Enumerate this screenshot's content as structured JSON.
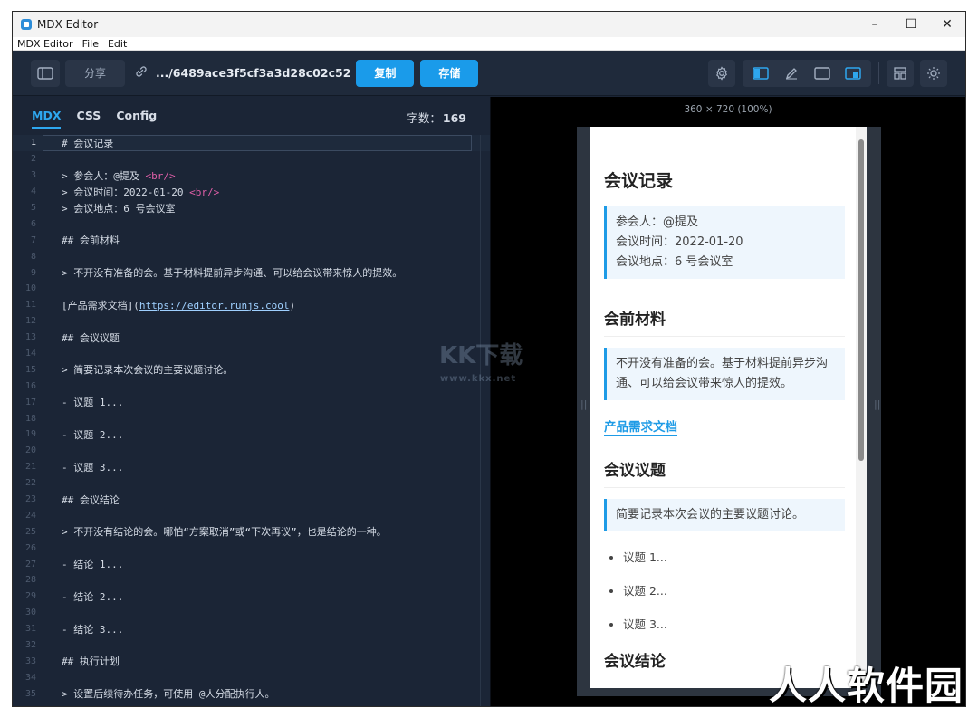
{
  "window": {
    "title": "MDX Editor",
    "controls": [
      "–",
      "☐",
      "✕"
    ]
  },
  "menu": [
    "MDX Editor",
    "File",
    "Edit"
  ],
  "toolbar": {
    "share_label": "分享",
    "path": ".../6489ace3f5cf3a3d28c02c52",
    "copy_label": "复制",
    "save_label": "存储",
    "icons": [
      "sidebar-icon",
      "link-icon",
      "gear-icon",
      "split-view-icon",
      "edit-icon",
      "preview-icon",
      "mobile-preview-icon",
      "layout-icon",
      "theme-icon"
    ]
  },
  "editor": {
    "tabs": [
      "MDX",
      "CSS",
      "Config"
    ],
    "active_tab": "MDX",
    "wordcount_label": "字数：",
    "wordcount_value": "169",
    "lines": [
      {
        "n": "1",
        "t": "# 会议记录"
      },
      {
        "n": "2",
        "t": ""
      },
      {
        "n": "3",
        "t": "> 参会人：@提及 <br/>"
      },
      {
        "n": "4",
        "t": "> 会议时间：2022-01-20 <br/>"
      },
      {
        "n": "5",
        "t": "> 会议地点：6 号会议室"
      },
      {
        "n": "6",
        "t": ""
      },
      {
        "n": "7",
        "t": "## 会前材料"
      },
      {
        "n": "8",
        "t": ""
      },
      {
        "n": "9",
        "t": "> 不开没有准备的会。基于材料提前异步沟通、可以给会议带来惊人的提效。"
      },
      {
        "n": "10",
        "t": ""
      },
      {
        "n": "11",
        "t": "[产品需求文档](https://editor.runjs.cool)"
      },
      {
        "n": "12",
        "t": ""
      },
      {
        "n": "13",
        "t": "## 会议议题"
      },
      {
        "n": "14",
        "t": ""
      },
      {
        "n": "15",
        "t": "> 简要记录本次会议的主要议题讨论。"
      },
      {
        "n": "16",
        "t": ""
      },
      {
        "n": "17",
        "t": "- 议题 1..."
      },
      {
        "n": "18",
        "t": ""
      },
      {
        "n": "19",
        "t": "- 议题 2..."
      },
      {
        "n": "20",
        "t": ""
      },
      {
        "n": "21",
        "t": "- 议题 3..."
      },
      {
        "n": "22",
        "t": ""
      },
      {
        "n": "23",
        "t": "## 会议结论"
      },
      {
        "n": "24",
        "t": ""
      },
      {
        "n": "25",
        "t": "> 不开没有结论的会。哪怕“方案取消”或“下次再议”，也是结论的一种。"
      },
      {
        "n": "26",
        "t": ""
      },
      {
        "n": "27",
        "t": "- 结论 1..."
      },
      {
        "n": "28",
        "t": ""
      },
      {
        "n": "29",
        "t": "- 结论 2..."
      },
      {
        "n": "30",
        "t": ""
      },
      {
        "n": "31",
        "t": "- 结论 3..."
      },
      {
        "n": "32",
        "t": ""
      },
      {
        "n": "33",
        "t": "## 执行计划"
      },
      {
        "n": "34",
        "t": ""
      },
      {
        "n": "35",
        "t": "> 设置后续待办任务，可使用 @人分配执行人。"
      }
    ]
  },
  "preview": {
    "dimensions": "360 × 720 (100%)",
    "h1": "会议记录",
    "quote1": [
      "参会人：@提及",
      "会议时间：2022-01-20",
      "会议地点：6 号会议室"
    ],
    "h2_materials": "会前材料",
    "quote2": "不开没有准备的会。基于材料提前异步沟通、可以给会议带来惊人的提效。",
    "link": "产品需求文档",
    "h2_topics": "会议议题",
    "quote3": "简要记录本次会议的主要议题讨论。",
    "topics": [
      "议题 1...",
      "议题 2...",
      "议题 3..."
    ],
    "h2_conclusion": "会议结论"
  },
  "watermarks": {
    "center_main": "KK下载",
    "center_sub": "www.kkx.net",
    "corner": "人人软件园"
  }
}
